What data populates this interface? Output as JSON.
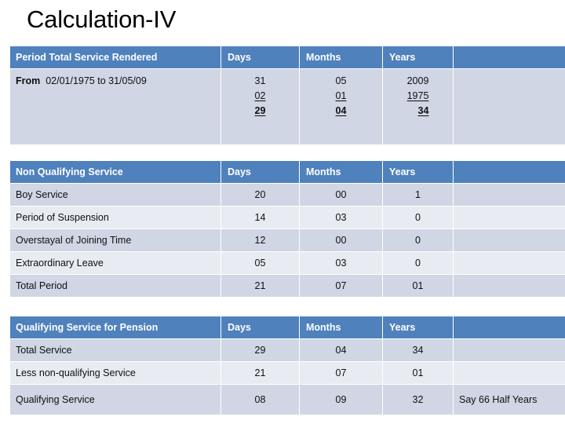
{
  "slide": {
    "title": "Calculation-IV",
    "accent_color": "#4f81bd",
    "band_color_a": "#d0d6e4",
    "band_color_b": "#e8ebf2"
  },
  "table_period": {
    "headers": {
      "label": "Period Total Service Rendered",
      "days": "Days",
      "months": "Months",
      "years": "Years",
      "note": ""
    },
    "row": {
      "lead": "From",
      "range": "02/01/1975 to 31/05/09",
      "days": [
        "31",
        "02",
        "29"
      ],
      "months": [
        "05",
        "01",
        "04"
      ],
      "years": [
        "2009",
        "1975",
        "34"
      ],
      "note": ""
    }
  },
  "table_nonqualifying": {
    "headers": {
      "label": "Non Qualifying Service",
      "days": "Days",
      "months": "Months",
      "years": "Years",
      "note": ""
    },
    "rows": [
      {
        "label": "Boy Service",
        "days": "20",
        "months": "00",
        "years": "1",
        "note": ""
      },
      {
        "label": "Period of Suspension",
        "days": "14",
        "months": "03",
        "years": "0",
        "note": ""
      },
      {
        "label": "Overstayal of Joining Time",
        "days": "12",
        "months": "00",
        "years": "0",
        "note": ""
      },
      {
        "label": "Extraordinary Leave",
        "days": "05",
        "months": "03",
        "years": "0",
        "note": ""
      },
      {
        "label": "Total Period",
        "days": "21",
        "months": "07",
        "years": "01",
        "note": ""
      }
    ]
  },
  "table_qualifying": {
    "headers": {
      "label": "Qualifying Service for Pension",
      "days": "Days",
      "months": "Months",
      "years": "Years",
      "note": ""
    },
    "rows": [
      {
        "label": "Total Service",
        "days": "29",
        "months": "04",
        "years": "34",
        "note": ""
      },
      {
        "label": "Less non-qualifying Service",
        "days": "21",
        "months": "07",
        "years": "01",
        "note": ""
      },
      {
        "label": "Qualifying Service",
        "days": "08",
        "months": "09",
        "years": "32",
        "note": "Say 66 Half Years"
      }
    ]
  }
}
